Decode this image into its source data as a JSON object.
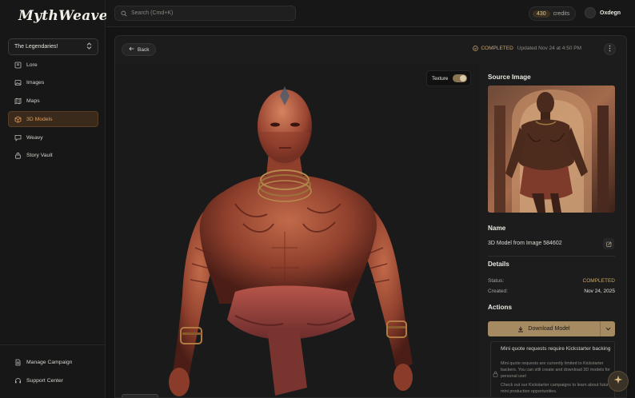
{
  "app": {
    "logo": "MythWeaver"
  },
  "sidebar": {
    "campaign_selected": "The Legendaries!",
    "items": [
      {
        "label": "Lore",
        "icon": "book-icon"
      },
      {
        "label": "Images",
        "icon": "images-icon"
      },
      {
        "label": "Maps",
        "icon": "map-icon"
      },
      {
        "label": "3D Models",
        "icon": "cube-icon",
        "active": true
      },
      {
        "label": "Weavy",
        "icon": "chat-icon"
      },
      {
        "label": "Story Vault",
        "icon": "vault-icon"
      }
    ],
    "bottom": [
      {
        "label": "Manage Campaign",
        "icon": "campaign-icon"
      },
      {
        "label": "Support Center",
        "icon": "headset-icon"
      }
    ]
  },
  "topbar": {
    "search_placeholder": "Search (Cmd+K)",
    "credits_count": "430",
    "credits_label": "credits",
    "username": "Oxdegn"
  },
  "page": {
    "back_label": "Back",
    "status": "COMPLETED",
    "updated": "Updated Nov 24 at 4:50 PM",
    "texture_label": "Texture",
    "texture_on": true
  },
  "details": {
    "source_heading": "Source Image",
    "name_heading": "Name",
    "name_value": "3D Model from Image 584602",
    "details_heading": "Details",
    "status_label": "Status:",
    "status_value": "COMPLETED",
    "created_label": "Created:",
    "created_value": "Nov 24, 2025",
    "actions_heading": "Actions",
    "download_label": "Download Model"
  },
  "notice": {
    "title": "Mini quote requests require Kickstarter backing",
    "p1": "Mini quote requests are currently limited to Kickstarter backers. You can still create and download 3D models for personal use!",
    "p2": "Check out our Kickstarter campaigns to learn about future mini production opportunities."
  },
  "colors": {
    "accent": "#e29a55",
    "gold": "#a58a62",
    "completed": "#c9a56b"
  }
}
